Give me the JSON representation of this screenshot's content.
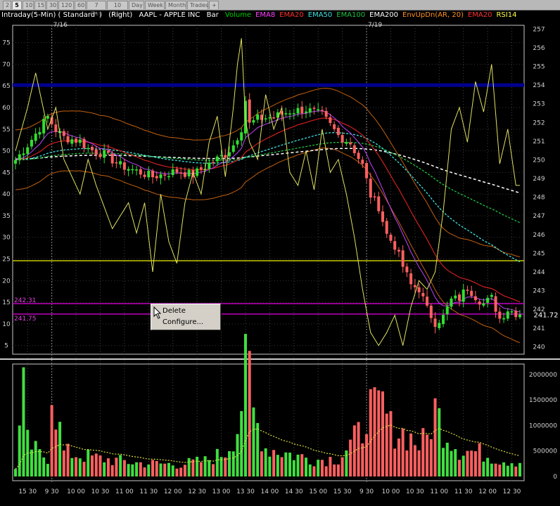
{
  "tabs": [
    "2",
    "5",
    "10",
    "15",
    "30",
    "120",
    "60",
    "7 Day",
    "10 Day",
    "Day",
    "Week",
    "Month",
    "Trades",
    "+"
  ],
  "active_tab": 1,
  "header": {
    "description": "Intraday(5-Min) ( Standard' )",
    "scale": "(Right)",
    "symbol": "AAPL - APPLE INC",
    "bar": "Bar",
    "studies": [
      {
        "label": "Volume",
        "color": "#00d000"
      },
      {
        "label": "EMA8",
        "color": "#ff40ff"
      },
      {
        "label": "EMA20",
        "color": "#ff3030"
      },
      {
        "label": "EMA50",
        "color": "#40e0e0"
      },
      {
        "label": "EMA100",
        "color": "#20c040"
      },
      {
        "label": "EMA200",
        "color": "#ffffff"
      },
      {
        "label": "EnvUpDn(AR, 20)",
        "color": "#ff9020"
      },
      {
        "label": "EMA20",
        "color": "#ff3030"
      },
      {
        "label": "RSI14",
        "color": "#ffff40"
      }
    ]
  },
  "date_labels": [
    "7/16",
    "7/19"
  ],
  "context_menu": {
    "items": [
      "Delete",
      "Configure..."
    ]
  },
  "price_panel": {
    "ylim": [
      239.6,
      257.2
    ],
    "ticks": [
      240,
      241,
      242,
      243,
      244,
      245,
      246,
      247,
      248,
      249,
      250,
      251,
      252,
      253,
      254,
      255,
      256,
      257
    ],
    "last_price": "241.72",
    "tag_high": "242.31",
    "tag_low": "241.75",
    "hlines": [
      {
        "value": 254.0,
        "color": "#000090",
        "name": "blue-level-line"
      },
      {
        "value": 244.6,
        "color": "#c8c800",
        "name": "yellow-level-line"
      },
      {
        "value": 242.31,
        "color": "#c000c0",
        "name": "magenta-level-high"
      },
      {
        "value": 241.75,
        "color": "#c000c0",
        "name": "magenta-level-low"
      }
    ]
  },
  "rsi_axis": {
    "ylim": [
      3,
      79
    ],
    "ticks": [
      5,
      10,
      15,
      20,
      25,
      30,
      35,
      40,
      45,
      50,
      55,
      60,
      65,
      70,
      75
    ]
  },
  "volume_panel": {
    "ylim": [
      0,
      2150000
    ],
    "ticks": [
      {
        "v": 0,
        "label": "0"
      },
      {
        "v": 500000,
        "label": "500000"
      },
      {
        "v": 1000000,
        "label": "1000000"
      },
      {
        "v": 1500000,
        "label": "1500000"
      },
      {
        "v": 2000000,
        "label": "2000000"
      }
    ]
  },
  "time_axis": {
    "labels": [
      "15 30",
      "9 30",
      "10 00",
      "10 30",
      "11 00",
      "11 30",
      "12 00",
      "12 30",
      "13 00",
      "13 30",
      "14 00",
      "14 30",
      "15 00",
      "15 30",
      "9 30",
      "10 00",
      "10 30",
      "11 00",
      "11 30",
      "12 00",
      "12 30"
    ],
    "bar_index": [
      3,
      9,
      15,
      21,
      27,
      33,
      39,
      45,
      51,
      57,
      63,
      69,
      75,
      81,
      87,
      93,
      99,
      105,
      111,
      117,
      123
    ]
  },
  "chart_data": {
    "type": "candlestick",
    "symbol": "AAPL - APPLE INC",
    "interval": "5-Min",
    "price_anchors": [
      [
        0,
        250.0
      ],
      [
        3,
        250.8
      ],
      [
        6,
        251.7
      ],
      [
        8,
        252.3
      ],
      [
        10,
        251.6
      ],
      [
        12,
        251.2
      ],
      [
        16,
        251.0
      ],
      [
        18,
        250.6
      ],
      [
        22,
        250.3
      ],
      [
        26,
        249.7
      ],
      [
        30,
        249.4
      ],
      [
        34,
        249.1
      ],
      [
        38,
        249.3
      ],
      [
        40,
        249.4
      ],
      [
        44,
        249.2
      ],
      [
        48,
        249.8
      ],
      [
        52,
        250.3
      ],
      [
        54,
        250.8
      ],
      [
        56,
        251.7
      ],
      [
        57,
        253.2
      ],
      [
        58,
        251.9
      ],
      [
        60,
        252.2
      ],
      [
        64,
        252.3
      ],
      [
        68,
        252.6
      ],
      [
        72,
        252.7
      ],
      [
        76,
        252.4
      ],
      [
        80,
        251.3
      ],
      [
        83,
        250.9
      ],
      [
        86,
        249.7
      ],
      [
        88,
        248.1
      ],
      [
        90,
        247.5
      ],
      [
        92,
        246.0
      ],
      [
        94,
        245.4
      ],
      [
        96,
        244.3
      ],
      [
        98,
        243.3
      ],
      [
        100,
        243.1
      ],
      [
        102,
        242.0
      ],
      [
        104,
        241.3
      ],
      [
        106,
        241.6
      ],
      [
        108,
        242.5
      ],
      [
        110,
        242.6
      ],
      [
        112,
        243.2
      ],
      [
        114,
        242.7
      ],
      [
        116,
        242.3
      ],
      [
        118,
        242.6
      ],
      [
        120,
        241.5
      ],
      [
        122,
        242.0
      ],
      [
        124,
        241.8
      ],
      [
        125,
        241.72
      ]
    ],
    "volume_anchors": [
      [
        0,
        200000
      ],
      [
        2,
        1700000
      ],
      [
        3,
        700000
      ],
      [
        6,
        450000
      ],
      [
        8,
        400000
      ],
      [
        9,
        1950000
      ],
      [
        10,
        1400000
      ],
      [
        12,
        500000
      ],
      [
        20,
        380000
      ],
      [
        30,
        280000
      ],
      [
        40,
        250000
      ],
      [
        47,
        320000
      ],
      [
        52,
        500000
      ],
      [
        55,
        1000000
      ],
      [
        57,
        2100000
      ],
      [
        58,
        2050000
      ],
      [
        59,
        1300000
      ],
      [
        62,
        600000
      ],
      [
        70,
        420000
      ],
      [
        75,
        350000
      ],
      [
        80,
        380000
      ],
      [
        86,
        950000
      ],
      [
        87,
        1500000
      ],
      [
        89,
        1300000
      ],
      [
        91,
        1450000
      ],
      [
        93,
        1000000
      ],
      [
        96,
        900000
      ],
      [
        98,
        800000
      ],
      [
        100,
        650000
      ],
      [
        102,
        800000
      ],
      [
        104,
        1400000
      ],
      [
        106,
        1000000
      ],
      [
        110,
        550000
      ],
      [
        115,
        500000
      ],
      [
        120,
        350000
      ],
      [
        125,
        300000
      ]
    ],
    "rsi_anchors": [
      [
        0,
        50
      ],
      [
        3,
        60
      ],
      [
        5,
        68
      ],
      [
        8,
        55
      ],
      [
        10,
        60
      ],
      [
        12,
        48
      ],
      [
        16,
        40
      ],
      [
        18,
        48
      ],
      [
        20,
        42
      ],
      [
        24,
        32
      ],
      [
        28,
        38
      ],
      [
        30,
        31
      ],
      [
        32,
        38
      ],
      [
        34,
        22
      ],
      [
        36,
        40
      ],
      [
        38,
        29
      ],
      [
        40,
        24
      ],
      [
        42,
        38
      ],
      [
        44,
        45
      ],
      [
        46,
        40
      ],
      [
        48,
        52
      ],
      [
        50,
        58
      ],
      [
        52,
        44
      ],
      [
        54,
        60
      ],
      [
        55,
        70
      ],
      [
        56,
        76
      ],
      [
        57,
        57
      ],
      [
        58,
        52
      ],
      [
        60,
        48
      ],
      [
        62,
        63
      ],
      [
        64,
        55
      ],
      [
        66,
        60
      ],
      [
        68,
        45
      ],
      [
        70,
        42
      ],
      [
        72,
        50
      ],
      [
        74,
        41
      ],
      [
        76,
        55
      ],
      [
        78,
        45
      ],
      [
        80,
        48
      ],
      [
        82,
        40
      ],
      [
        84,
        30
      ],
      [
        86,
        18
      ],
      [
        88,
        8
      ],
      [
        90,
        5
      ],
      [
        92,
        8
      ],
      [
        94,
        12
      ],
      [
        96,
        5
      ],
      [
        98,
        14
      ],
      [
        100,
        20
      ],
      [
        102,
        18
      ],
      [
        104,
        22
      ],
      [
        106,
        36
      ],
      [
        108,
        55
      ],
      [
        110,
        60
      ],
      [
        112,
        52
      ],
      [
        114,
        66
      ],
      [
        116,
        59
      ],
      [
        118,
        70
      ],
      [
        120,
        47
      ],
      [
        122,
        55
      ],
      [
        124,
        42
      ]
    ]
  }
}
